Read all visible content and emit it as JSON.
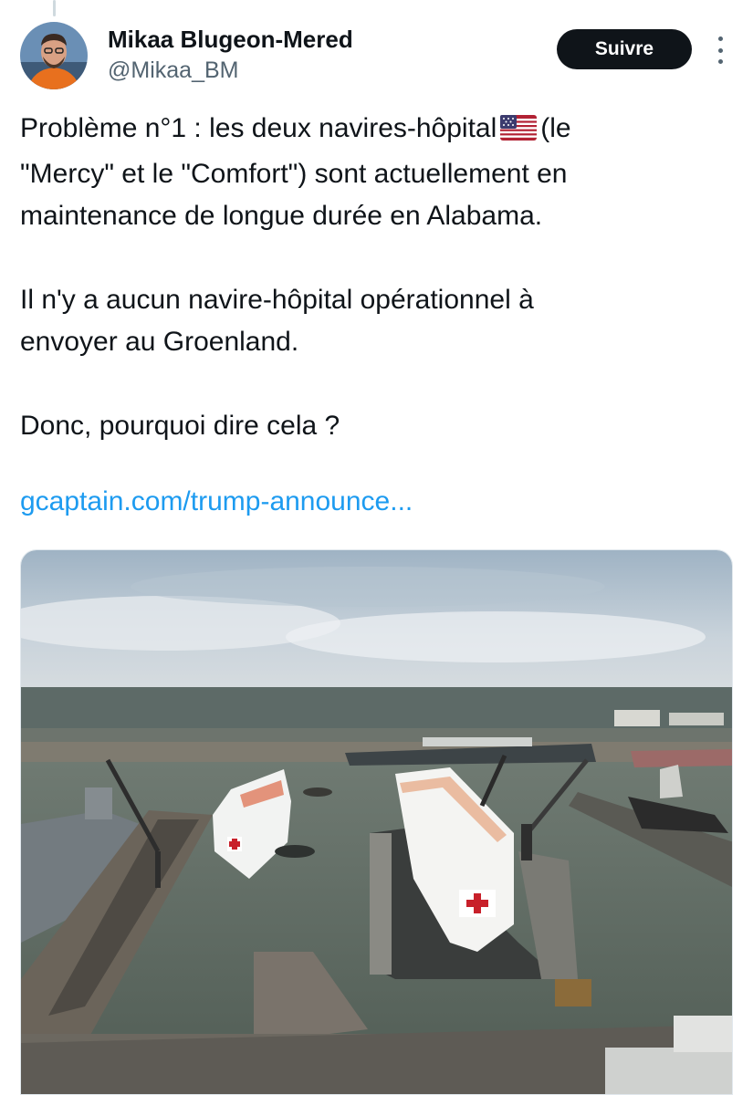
{
  "author": {
    "name": "Mikaa Blugeon-Mered",
    "handle": "@Mikaa_BM"
  },
  "follow_label": "Suivre",
  "tweet": {
    "line1_before_flag": "Problème n°1 : les deux navires-hôpital",
    "line1_after_flag": "(le",
    "line2": "\"Mercy\" et le \"Comfort\") sont actuellement en",
    "line3": "maintenance de longue durée en Alabama.",
    "line4": "Il n'y a aucun navire-hôpital opérationnel à",
    "line5": "envoyer au Groenland.",
    "line6": "Donc, pourquoi dire cela ?",
    "link": "gcaptain.com/trump-announce..."
  },
  "flag_icon": "us-flag-emoji",
  "colors": {
    "text": "#0f1419",
    "secondary": "#536471",
    "link": "#1d9bf0",
    "button_bg": "#0f1419"
  }
}
